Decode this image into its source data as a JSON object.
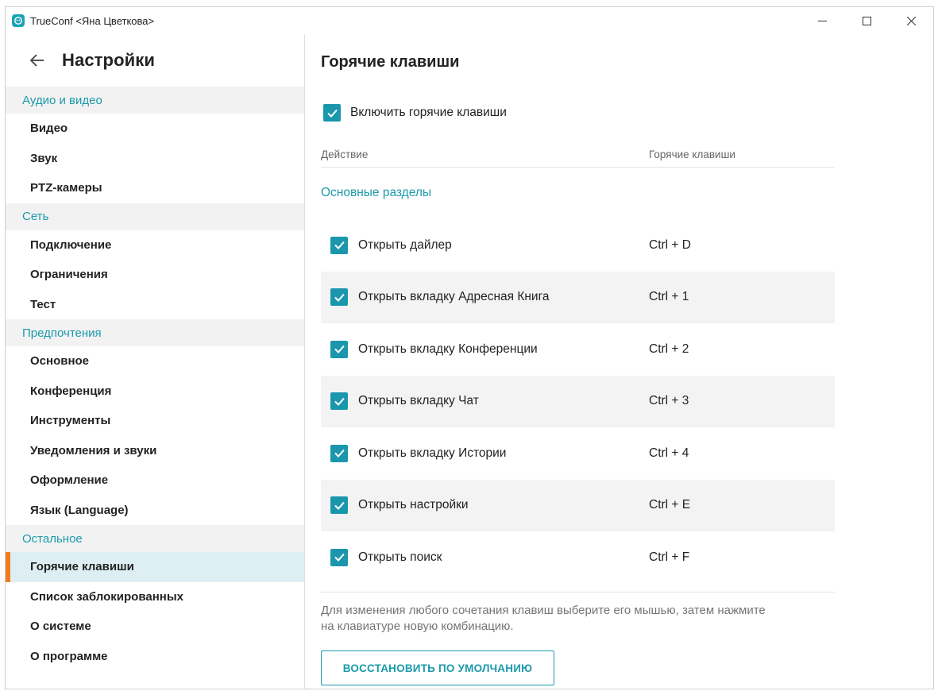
{
  "window": {
    "title": "TrueConf <Яна Цветкова>",
    "icon": "trueconf-app-icon"
  },
  "sidebar": {
    "title": "Настройки",
    "sections": [
      {
        "label": "Аудио и видео",
        "items": [
          {
            "label": "Видео"
          },
          {
            "label": "Звук"
          },
          {
            "label": "PTZ-камеры"
          }
        ]
      },
      {
        "label": "Сеть",
        "items": [
          {
            "label": "Подключение"
          },
          {
            "label": "Ограничения"
          },
          {
            "label": "Тест"
          }
        ]
      },
      {
        "label": "Предпочтения",
        "items": [
          {
            "label": "Основное"
          },
          {
            "label": "Конференция"
          },
          {
            "label": "Инструменты"
          },
          {
            "label": "Уведомления и звуки"
          },
          {
            "label": "Оформление"
          },
          {
            "label": "Язык (Language)"
          }
        ]
      },
      {
        "label": "Остальное",
        "items": [
          {
            "label": "Горячие клавиши",
            "active": true
          },
          {
            "label": "Список заблокированных"
          },
          {
            "label": "О системе"
          },
          {
            "label": "О программе"
          }
        ]
      }
    ]
  },
  "main": {
    "title": "Горячие клавиши",
    "enable_label": "Включить горячие клавиши",
    "enable_checked": true,
    "columns": {
      "action": "Действие",
      "keys": "Горячие клавиши"
    },
    "group_title": "Основные разделы",
    "rows": [
      {
        "action": "Открыть дайлер",
        "keys": "Ctrl + D",
        "checked": true
      },
      {
        "action": "Открыть вкладку Адресная Книга",
        "keys": "Ctrl + 1",
        "checked": true
      },
      {
        "action": "Открыть вкладку Конференции",
        "keys": "Ctrl + 2",
        "checked": true
      },
      {
        "action": "Открыть вкладку Чат",
        "keys": "Ctrl + 3",
        "checked": true
      },
      {
        "action": "Открыть вкладку Истории",
        "keys": "Ctrl + 4",
        "checked": true
      },
      {
        "action": "Открыть настройки",
        "keys": "Ctrl + E",
        "checked": true
      },
      {
        "action": "Открыть поиск",
        "keys": "Ctrl + F",
        "checked": true
      }
    ],
    "hint_line1": "Для изменения любого сочетания клавиш выберите его мышью, затем нажмите",
    "hint_line2": "на клавиатуре новую комбинацию.",
    "restore_label": "ВОССТАНОВИТЬ ПО УМОЛЧАНИЮ"
  },
  "colors": {
    "accent": "#1a97ac",
    "active_marker": "#f07c22",
    "active_bg": "#ddeff2",
    "section_bg": "#f2f2f2"
  }
}
